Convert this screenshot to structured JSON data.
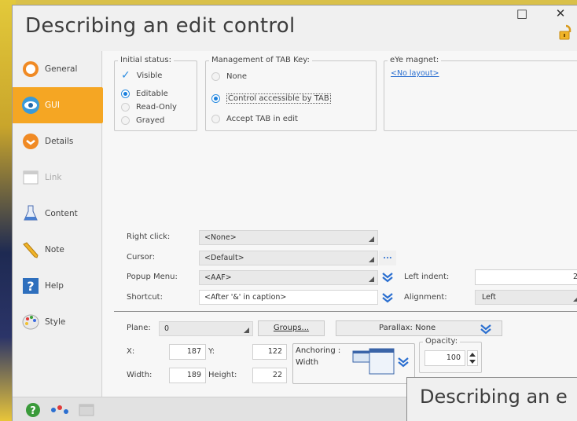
{
  "window": {
    "title": "Describing an edit control",
    "maximize_glyph": "□",
    "close_glyph": "✕"
  },
  "nav": {
    "items": [
      {
        "label": "General",
        "icon": "general-icon",
        "state": "normal"
      },
      {
        "label": "GUI",
        "icon": "eye-icon",
        "state": "active"
      },
      {
        "label": "Details",
        "icon": "details-icon",
        "state": "normal"
      },
      {
        "label": "Link",
        "icon": "link-icon",
        "state": "disabled"
      },
      {
        "label": "Content",
        "icon": "flask-icon",
        "state": "normal"
      },
      {
        "label": "Note",
        "icon": "pencil-icon",
        "state": "normal"
      },
      {
        "label": "Help",
        "icon": "help-icon",
        "state": "normal"
      },
      {
        "label": "Style",
        "icon": "palette-icon",
        "state": "normal"
      }
    ]
  },
  "initial_status": {
    "title": "Initial status:",
    "visible_label": "Visible",
    "visible_checked": true,
    "options": [
      "Editable",
      "Read-Only",
      "Grayed"
    ],
    "selected": "Editable"
  },
  "tab_key": {
    "title": "Management of TAB Key:",
    "options": [
      "None",
      "Control accessible by TAB",
      "Accept TAB in edit"
    ],
    "selected": "Control accessible by TAB"
  },
  "magnet": {
    "title": "eYe magnet:",
    "link": "<No layout>"
  },
  "fields": {
    "right_click_label": "Right click:",
    "right_click_value": "<None>",
    "cursor_label": "Cursor:",
    "cursor_value": "<Default>",
    "cursor_more": "...",
    "popup_label": "Popup Menu:",
    "popup_value": "<AAF>",
    "shortcut_label": "Shortcut:",
    "shortcut_value": "<After '&' in caption>",
    "left_indent_label": "Left indent:",
    "left_indent_value": "2",
    "alignment_label": "Alignment:",
    "alignment_value": "Left"
  },
  "position": {
    "plane_label": "Plane:",
    "plane_value": "0",
    "groups_label": "Groups...",
    "parallax_label": "Parallax: None",
    "x_label": "X:",
    "x_value": "187",
    "y_label": "Y:",
    "y_value": "122",
    "width_label": "Width:",
    "width_value": "189",
    "height_label": "Height:",
    "height_value": "22",
    "anchoring_label": "Anchoring :",
    "anchoring_value": "Width",
    "opacity_label": "Opacity:",
    "opacity_value": "100"
  },
  "background_window": {
    "title": "Describing an e"
  },
  "colors": {
    "accent": "#f5a623",
    "radio_blue": "#1a7fdc",
    "link_blue": "#2b6fd0"
  }
}
